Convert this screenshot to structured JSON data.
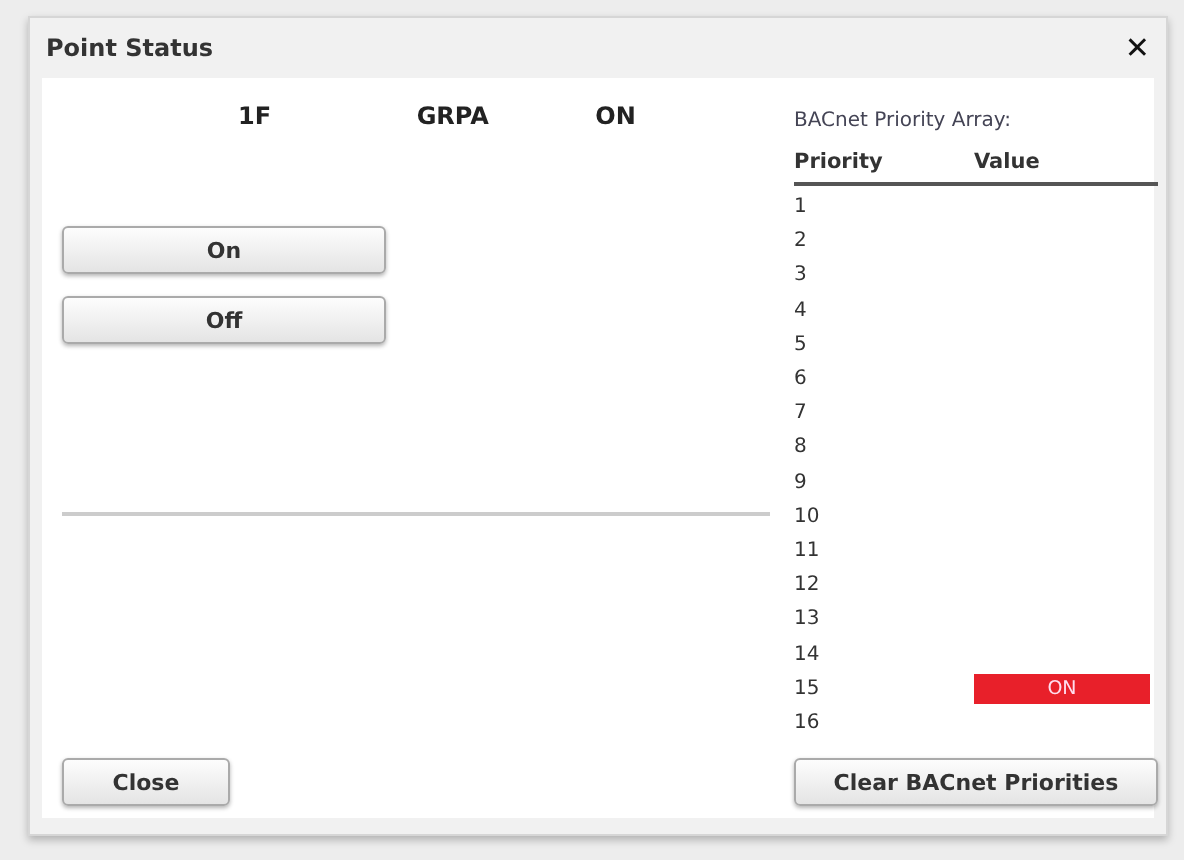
{
  "dialog": {
    "title": "Point Status",
    "close_icon": "✕"
  },
  "point": {
    "fields": [
      "1F",
      "GRPA",
      "ON"
    ]
  },
  "buttons": [
    {
      "label": "On"
    },
    {
      "label": "Off"
    }
  ],
  "close_button": "Close",
  "priority_array": {
    "title": "BACnet Priority Array:",
    "columns": [
      "Priority",
      "Value"
    ],
    "rows": [
      {
        "priority": "1"
      },
      {
        "priority": "2"
      },
      {
        "priority": "3"
      },
      {
        "priority": "4"
      },
      {
        "priority": "5"
      },
      {
        "priority": "6"
      },
      {
        "priority": "7"
      },
      {
        "priority": "8"
      },
      {
        "priority": "9"
      },
      {
        "priority": "10"
      },
      {
        "priority": "11"
      },
      {
        "priority": "12"
      },
      {
        "priority": "13"
      },
      {
        "priority": "14"
      },
      {
        "priority": "15",
        "value": "ON"
      },
      {
        "priority": "16"
      }
    ],
    "clear_button": "Clear BACnet Priorities"
  }
}
